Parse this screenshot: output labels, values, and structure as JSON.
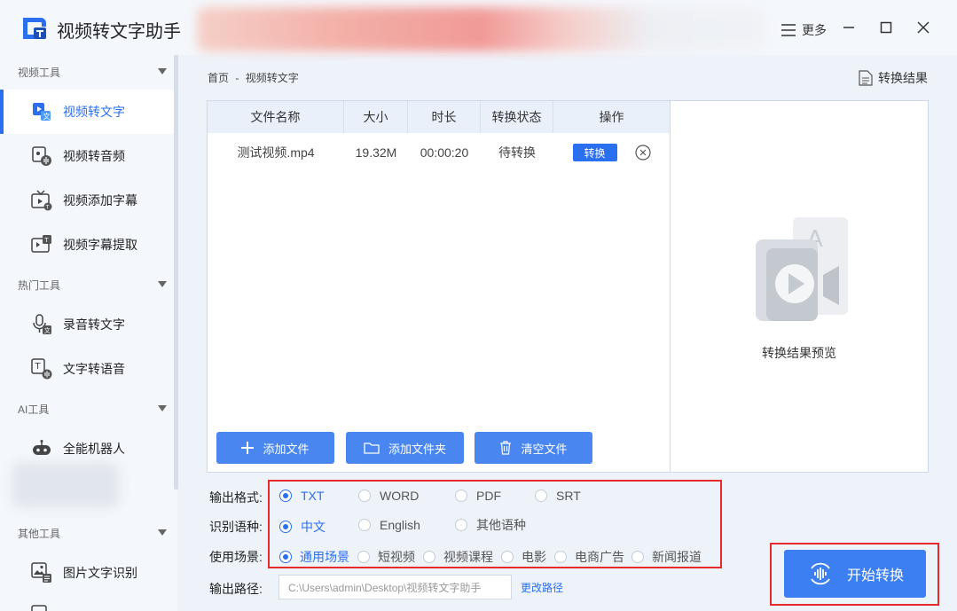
{
  "app": {
    "title": "视频转文字助手",
    "more_label": "更多"
  },
  "sidebar": {
    "groups": [
      {
        "label": "视频工具"
      },
      {
        "label": "热门工具"
      },
      {
        "label": "AI工具"
      },
      {
        "label": "其他工具"
      }
    ],
    "items": [
      {
        "label": "视频转文字",
        "icon": "video-to-text-icon"
      },
      {
        "label": "视频转音频",
        "icon": "video-to-audio-icon"
      },
      {
        "label": "视频添加字幕",
        "icon": "subtitle-add-icon"
      },
      {
        "label": "视频字幕提取",
        "icon": "subtitle-extract-icon"
      },
      {
        "label": "录音转文字",
        "icon": "mic-text-icon"
      },
      {
        "label": "文字转语音",
        "icon": "text-speech-icon"
      },
      {
        "label": "全能机器人",
        "icon": "robot-icon"
      },
      {
        "label": "图片文字识别",
        "icon": "image-ocr-icon"
      }
    ]
  },
  "breadcrumb": {
    "home": "首页",
    "sep": "-",
    "current": "视频转文字"
  },
  "result_link": "转换结果",
  "table": {
    "headers": [
      "文件名称",
      "大小",
      "时长",
      "转换状态",
      "操作"
    ],
    "rows": [
      {
        "name": "测试视频.mp4",
        "size": "19.32M",
        "duration": "00:00:20",
        "status": "待转换",
        "action": "转换"
      }
    ]
  },
  "buttons": {
    "add_file": "添加文件",
    "add_folder": "添加文件夹",
    "clear": "清空文件",
    "start": "开始转换"
  },
  "preview": {
    "label": "转换结果预览"
  },
  "options": {
    "format_label": "输出格式:",
    "formats": [
      "TXT",
      "WORD",
      "PDF",
      "SRT"
    ],
    "language_label": "识别语种:",
    "languages": [
      "中文",
      "English",
      "其他语种"
    ],
    "scene_label": "使用场景:",
    "scenes": [
      "通用场景",
      "短视频",
      "视频课程",
      "电影",
      "电商广告",
      "新闻报道"
    ],
    "path_label": "输出路径:",
    "path_value": "C:\\Users\\admin\\Desktop\\视频转文字助手",
    "change_path": "更改路径"
  },
  "colors": {
    "accent": "#2a6ff0",
    "highlight": "#e52b2b",
    "sidebar_bg": "#f4f7fc"
  }
}
